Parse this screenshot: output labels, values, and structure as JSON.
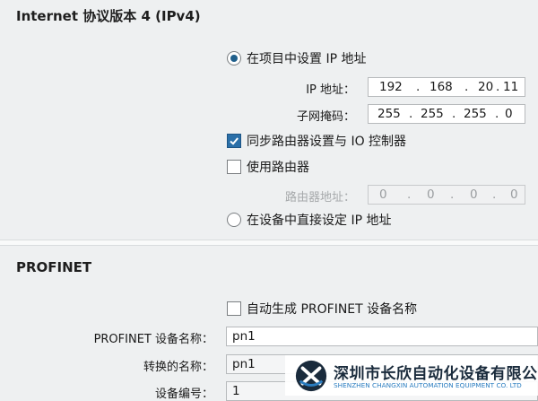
{
  "ipv4": {
    "title": "Internet 协议版本 4 (IPv4)",
    "set_in_project_label": "在项目中设置 IP 地址",
    "ip_label": "IP 地址：",
    "ip": [
      "192",
      "168",
      "20",
      "11"
    ],
    "subnet_label": "子网掩码：",
    "subnet": [
      "255",
      "255",
      "255",
      "0"
    ],
    "sync_router_label": "同步路由器设置与 IO 控制器",
    "use_router_label": "使用路由器",
    "router_addr_label": "路由器地址：",
    "router": [
      "0",
      "0",
      "0",
      "0"
    ],
    "set_on_device_label": "在设备中直接设定 IP 地址"
  },
  "profinet": {
    "title": "PROFINET",
    "auto_gen_label": "自动生成 PROFINET 设备名称",
    "device_name_label": "PROFINET 设备名称：",
    "device_name": "pn1",
    "converted_name_label": "转换的名称：",
    "converted_name": "pn1",
    "device_number_label": "设备编号：",
    "device_number": "1"
  },
  "watermark": {
    "company_cn": "深圳市长欣自动化设备有限公司",
    "company_en": "SHENZHEN CHANGXIN AUTOMATION EQUIPMENT CO. LTD"
  }
}
